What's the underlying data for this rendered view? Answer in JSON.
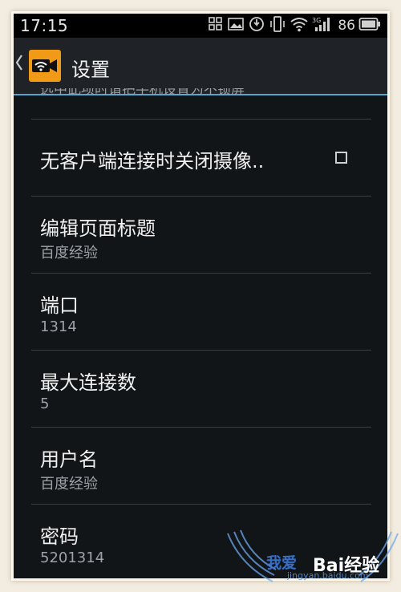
{
  "status_bar": {
    "time": "17:15",
    "battery_level": "86",
    "icons": [
      "grid-icon",
      "image-icon",
      "sync-icon",
      "vibrate-icon",
      "wifi-icon",
      "signal-3g-icon",
      "battery-icon"
    ]
  },
  "action_bar": {
    "back_icon": "chevron-left-icon",
    "app_icon": "webcam-wifi-icon",
    "title": "设置"
  },
  "settings": {
    "partial_summary": "选中此项时请把手机设置为不锁屏",
    "items": [
      {
        "title": "无客户端连接时关闭摄像..",
        "checked": false
      },
      {
        "title": "编辑页面标题",
        "summary": "百度经验"
      },
      {
        "title": "端口",
        "summary": "1314"
      },
      {
        "title": "最大连接数",
        "summary": "5"
      },
      {
        "title": "用户名",
        "summary": "百度经验"
      },
      {
        "title": "密码",
        "summary": "5201314"
      }
    ]
  },
  "watermark": {
    "text": "我爱",
    "brand": "Bai经验",
    "url": "jingyan.baidu.com"
  },
  "colors": {
    "accent": "#4fa6cf",
    "app_icon_bg": "#f19a17",
    "background": "#121518",
    "frame": "#f3ede1"
  }
}
